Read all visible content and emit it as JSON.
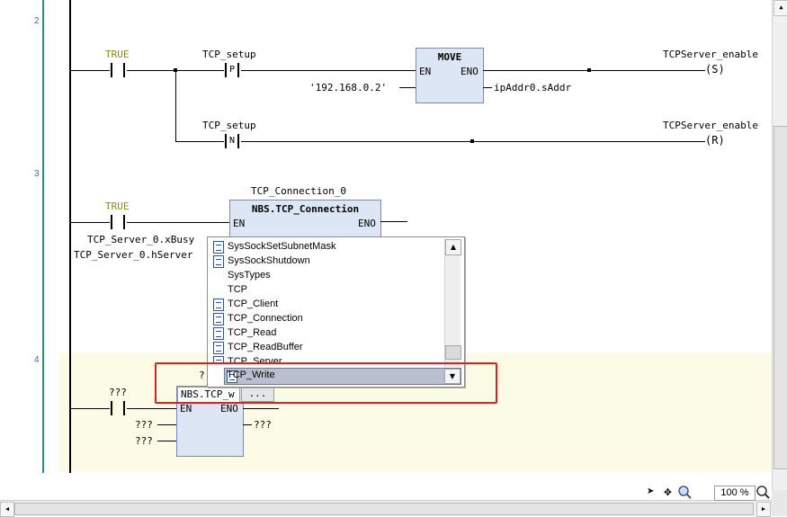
{
  "rungs": [
    {
      "number": "2"
    },
    {
      "number": "3"
    },
    {
      "number": "4"
    }
  ],
  "rung2": {
    "contact_true": "TRUE",
    "setup_p_label": "TCP_setup",
    "setup_p_glyph": "P",
    "move_block_title": "MOVE",
    "move_en": "EN",
    "move_eno": "ENO",
    "move_input": "'192.168.0.2'",
    "move_output": "ipAddr0.sAddr",
    "coil_set_label": "TCPServer_enable",
    "coil_set_glyph": "S",
    "setup_n_label": "TCP_setup",
    "setup_n_glyph": "N",
    "coil_reset_label": "TCPServer_enable",
    "coil_reset_glyph": "R"
  },
  "rung3": {
    "contact_true": "TRUE",
    "instance_name": "TCP_Connection_0",
    "block_title": "NBS.TCP_Connection",
    "en": "EN",
    "eno": "ENO",
    "input1": "TCP_Server_0.xBusy",
    "input2": "TCP_Server_0.hServer"
  },
  "rung4": {
    "contact_label": "???",
    "instance_label": "?",
    "block_title_typed": "NBS.TCP_w",
    "ellipsis_button": "...",
    "en": "EN",
    "eno": "ENO",
    "input1": "???",
    "input2": "???",
    "output1": "???"
  },
  "autocomplete": {
    "items": [
      {
        "label": "SysSockSetSubnetMask",
        "icon": "document-icon"
      },
      {
        "label": "SysSockShutdown",
        "icon": "document-icon"
      },
      {
        "label": "SysTypes",
        "icon": ""
      },
      {
        "label": "TCP",
        "icon": ""
      },
      {
        "label": "TCP_Client",
        "icon": "document-icon"
      },
      {
        "label": "TCP_Connection",
        "icon": "document-icon"
      },
      {
        "label": "TCP_Read",
        "icon": "document-icon"
      },
      {
        "label": "TCP_ReadBuffer",
        "icon": "document-icon"
      },
      {
        "label": "TCP_Server",
        "icon": "document-icon"
      }
    ],
    "selected": "TCP_Write"
  },
  "statusbar": {
    "zoom": "100 %"
  },
  "colors": {
    "highlight_rung": "#fbfbe6",
    "fb_fill": "#dde6f5",
    "red_annotation": "#e02020",
    "rung_rail": "#2e8b8b"
  }
}
